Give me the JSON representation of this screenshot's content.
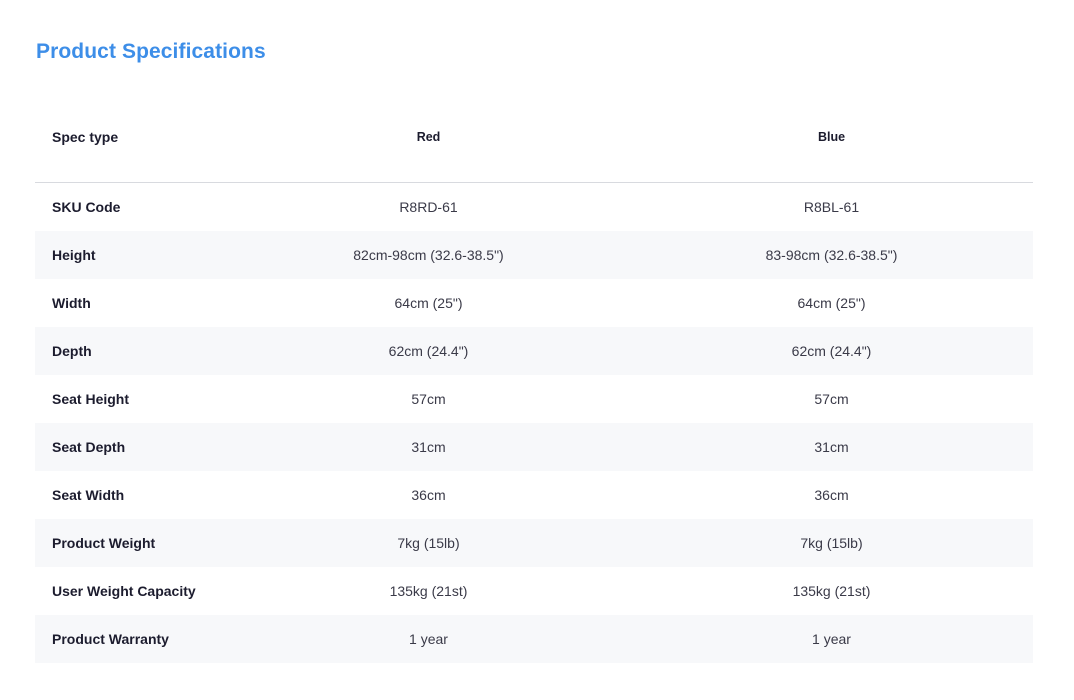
{
  "title": "Product Specifications",
  "table": {
    "headers": [
      "Spec type",
      "Red",
      "Blue"
    ],
    "rows": [
      {
        "label": "SKU Code",
        "red": "R8RD-61",
        "blue": "R8BL-61"
      },
      {
        "label": "Height",
        "red": "82cm-98cm (32.6-38.5\")",
        "blue": "83-98cm (32.6-38.5\")"
      },
      {
        "label": "Width",
        "red": "64cm (25\")",
        "blue": "64cm (25\")"
      },
      {
        "label": "Depth",
        "red": "62cm (24.4\")",
        "blue": "62cm (24.4\")"
      },
      {
        "label": "Seat Height",
        "red": "57cm",
        "blue": "57cm"
      },
      {
        "label": "Seat Depth",
        "red": "31cm",
        "blue": "31cm"
      },
      {
        "label": "Seat Width",
        "red": "36cm",
        "blue": "36cm"
      },
      {
        "label": "Product Weight",
        "red": "7kg (15lb)",
        "blue": "7kg (15lb)"
      },
      {
        "label": "User Weight Capacity",
        "red": "135kg (21st)",
        "blue": "135kg (21st)"
      },
      {
        "label": "Product Warranty",
        "red": "1 year",
        "blue": "1 year"
      }
    ]
  },
  "colors": {
    "title": "#3d8ee8",
    "text": "#1c1c2e",
    "stripe": "#f7f8fa",
    "divider": "#d8dadf"
  }
}
